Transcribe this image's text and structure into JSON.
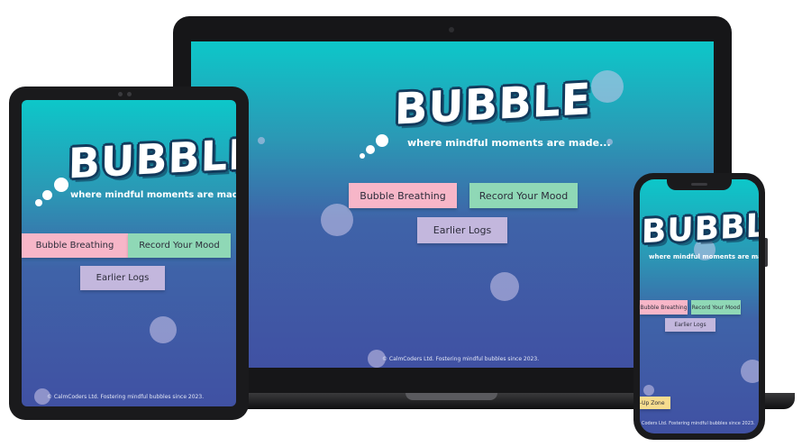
{
  "app": {
    "logo": "BUBBLE",
    "tagline": "where mindful moments are made...",
    "buttons": {
      "breathing": "Bubble Breathing",
      "mood": "Record Your Mood",
      "logs": "Earlier Logs",
      "zone": "-Up Zone"
    },
    "footer_laptop": "© CalmCoders Ltd. Fostering mindful bubbles since 2023.",
    "footer_tablet": "© CalmCoders Ltd. Fostering mindful bubbles since 2023.",
    "footer_phone": "Coders Ltd. Fostering mindful bubbles since 2023."
  },
  "colors": {
    "gradient_top": "#0dc7c9",
    "gradient_bottom": "#4051a3",
    "breathing_button": "#f7b6c8",
    "mood_button": "#8fd8b6",
    "logs_button": "#c3b7dd",
    "zone_button": "#f6dc8e",
    "device_frame": "#1c1c1e"
  }
}
